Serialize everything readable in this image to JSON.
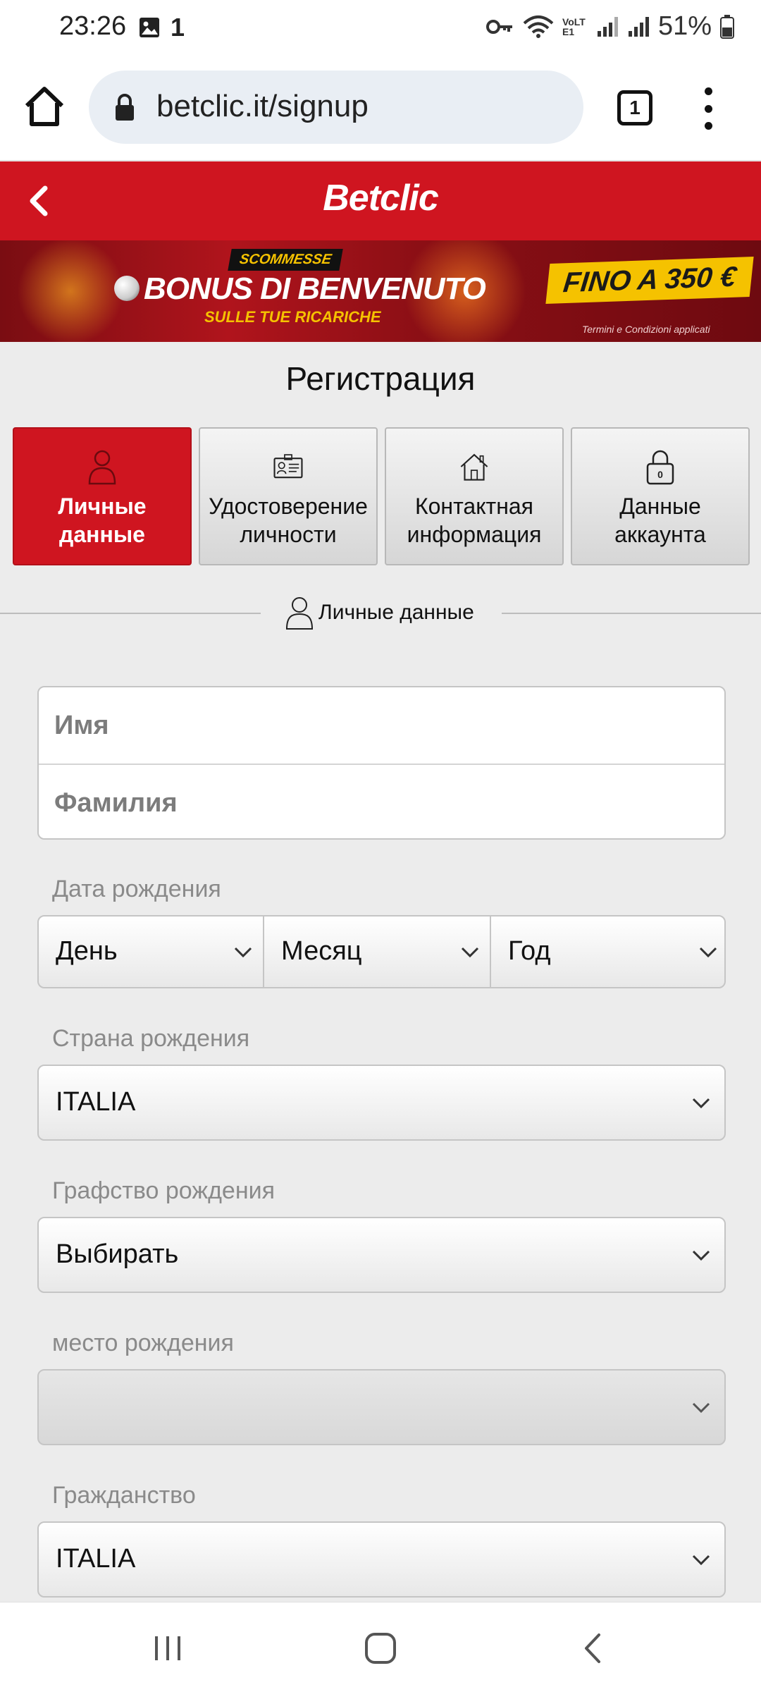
{
  "status": {
    "time": "23:26",
    "notification_count": "1",
    "network": "VoLTE1",
    "battery": "51%"
  },
  "browser": {
    "url": "betclic.it/signup",
    "tab_count": "1"
  },
  "header": {
    "brand": "Betclic"
  },
  "banner": {
    "tag": "SCOMMESSE",
    "title": "BONUS DI BENVENUTO",
    "subtitle": "SULLE TUE RICARICHE",
    "bonus": "FINO A 350 €",
    "terms": "Termini e Condizioni applicati"
  },
  "page": {
    "title": "Регистрация"
  },
  "steps": [
    {
      "label_1": "Личные",
      "label_2": "данные",
      "icon": "person-icon"
    },
    {
      "label_1": "Удостоверение",
      "label_2": "личности",
      "icon": "id-card-icon"
    },
    {
      "label_1": "Контактная",
      "label_2": "информация",
      "icon": "house-icon"
    },
    {
      "label_1": "Данные",
      "label_2": "аккаунта",
      "icon": "lock-icon"
    }
  ],
  "section": {
    "title": "Личные данные"
  },
  "form": {
    "first_name_placeholder": "Имя",
    "last_name_placeholder": "Фамилия",
    "dob_label": "Дата рождения",
    "day": "День",
    "month": "Месяц",
    "year": "Год",
    "birth_country_label": "Страна рождения",
    "birth_country_value": "ITALIA",
    "birth_county_label": "Графство рождения",
    "birth_county_value": "Выбирать",
    "birthplace_label": "место рождения",
    "birthplace_value": "",
    "citizenship_label": "Гражданство",
    "citizenship_value": "ITALIA"
  },
  "colors": {
    "brand_red": "#cf1520",
    "banner_yellow": "#f5c200"
  }
}
